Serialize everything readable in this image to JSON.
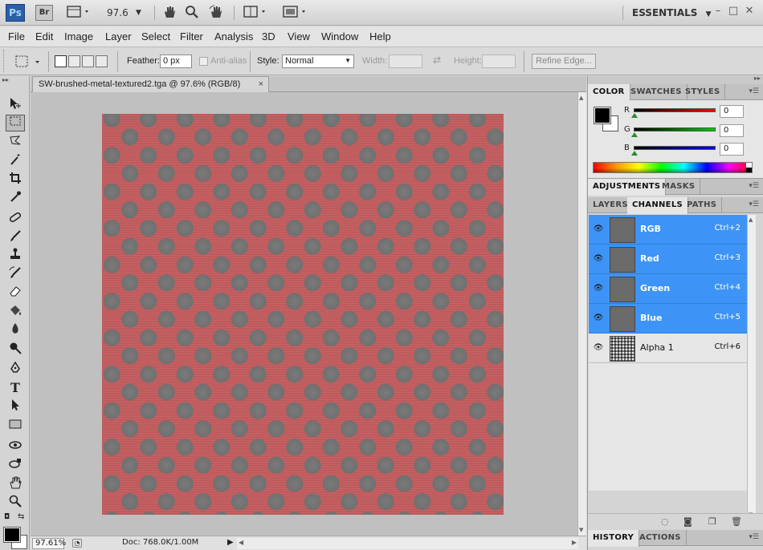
{
  "appbar": {
    "ps_logo": "Ps",
    "br_logo": "Br",
    "zoom": "97.6",
    "workspace": "ESSENTIALS"
  },
  "menu": [
    "File",
    "Edit",
    "Image",
    "Layer",
    "Select",
    "Filter",
    "Analysis",
    "3D",
    "View",
    "Window",
    "Help"
  ],
  "options": {
    "feather_label": "Feather:",
    "feather_value": "0 px",
    "antialias_label": "Anti-alias",
    "style_label": "Style:",
    "style_value": "Normal",
    "width_label": "Width:",
    "height_label": "Height:",
    "refine_edge": "Refine Edge..."
  },
  "document": {
    "tab_title": "SW-brushed-metal-textured2.tga @ 97.6% (RGB/8)",
    "close_glyph": "×",
    "colors": {
      "base": "#bf5a5c",
      "dots": "#707070"
    }
  },
  "status": {
    "zoom": "97.61%",
    "doc_size": "Doc: 768.0K/1.00M"
  },
  "color_panel": {
    "tabs": [
      "COLOR",
      "SWATCHES",
      "STYLES"
    ],
    "channels": [
      {
        "label": "R",
        "value": "0"
      },
      {
        "label": "G",
        "value": "0"
      },
      {
        "label": "B",
        "value": "0"
      }
    ]
  },
  "adjustments_tabs": [
    "ADJUSTMENTS",
    "MASKS"
  ],
  "layers_tabs": [
    "LAYERS",
    "CHANNELS",
    "PATHS"
  ],
  "channels": [
    {
      "name": "RGB",
      "shortcut": "Ctrl+2",
      "selected": true
    },
    {
      "name": "Red",
      "shortcut": "Ctrl+3",
      "selected": true
    },
    {
      "name": "Green",
      "shortcut": "Ctrl+4",
      "selected": true
    },
    {
      "name": "Blue",
      "shortcut": "Ctrl+5",
      "selected": true
    },
    {
      "name": "Alpha 1",
      "shortcut": "Ctrl+6",
      "selected": false
    }
  ],
  "history_tabs": [
    "HISTORY",
    "ACTIONS"
  ],
  "icons": {
    "tools": [
      "move-icon",
      "rect-marquee-icon",
      "lasso-icon",
      "magic-wand-icon",
      "crop-icon",
      "eyedropper-icon",
      "healing-brush-icon",
      "brush-icon",
      "clone-stamp-icon",
      "history-brush-icon",
      "eraser-icon",
      "paint-bucket-icon",
      "blur-icon",
      "dodge-icon",
      "pen-icon",
      "type-icon",
      "path-select-icon",
      "shape-icon",
      "3d-rotate-icon",
      "3d-orbit-icon",
      "hand-icon",
      "zoom-icon"
    ]
  }
}
